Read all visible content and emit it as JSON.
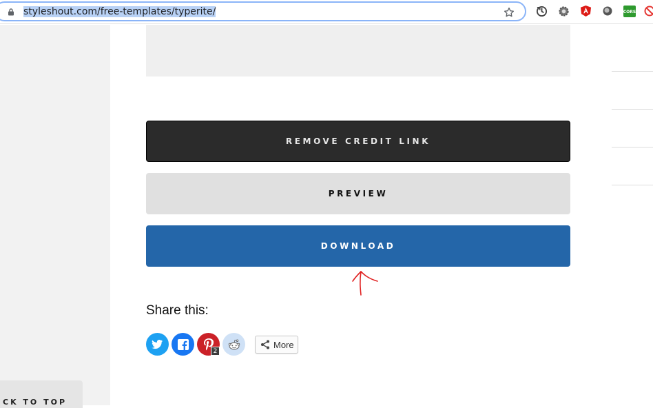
{
  "browser": {
    "url": "styleshout.com/free-templates/typerite/",
    "extensions": [
      {
        "name": "sync-icon"
      },
      {
        "name": "settings-gear-icon"
      },
      {
        "name": "angular-icon",
        "color": "#dd1b16"
      },
      {
        "name": "circle-extension-icon"
      },
      {
        "name": "cors-icon",
        "label": "CORS",
        "color": "#2e9a2e"
      },
      {
        "name": "blocker-icon",
        "color": "#e53935"
      }
    ]
  },
  "page": {
    "buttons": {
      "remove_credit": "REMOVE CREDIT LINK",
      "preview": "PREVIEW",
      "download": "DOWNLOAD"
    },
    "share": {
      "title": "Share this:",
      "pinterest_count": "2",
      "more_label": "More"
    },
    "back_to_top": "CK TO TOP"
  },
  "colors": {
    "download_blue": "#2466a9",
    "credit_dark": "#2b2b2b",
    "preview_gray": "#e0e0e0",
    "annotation_red": "#e02020"
  }
}
